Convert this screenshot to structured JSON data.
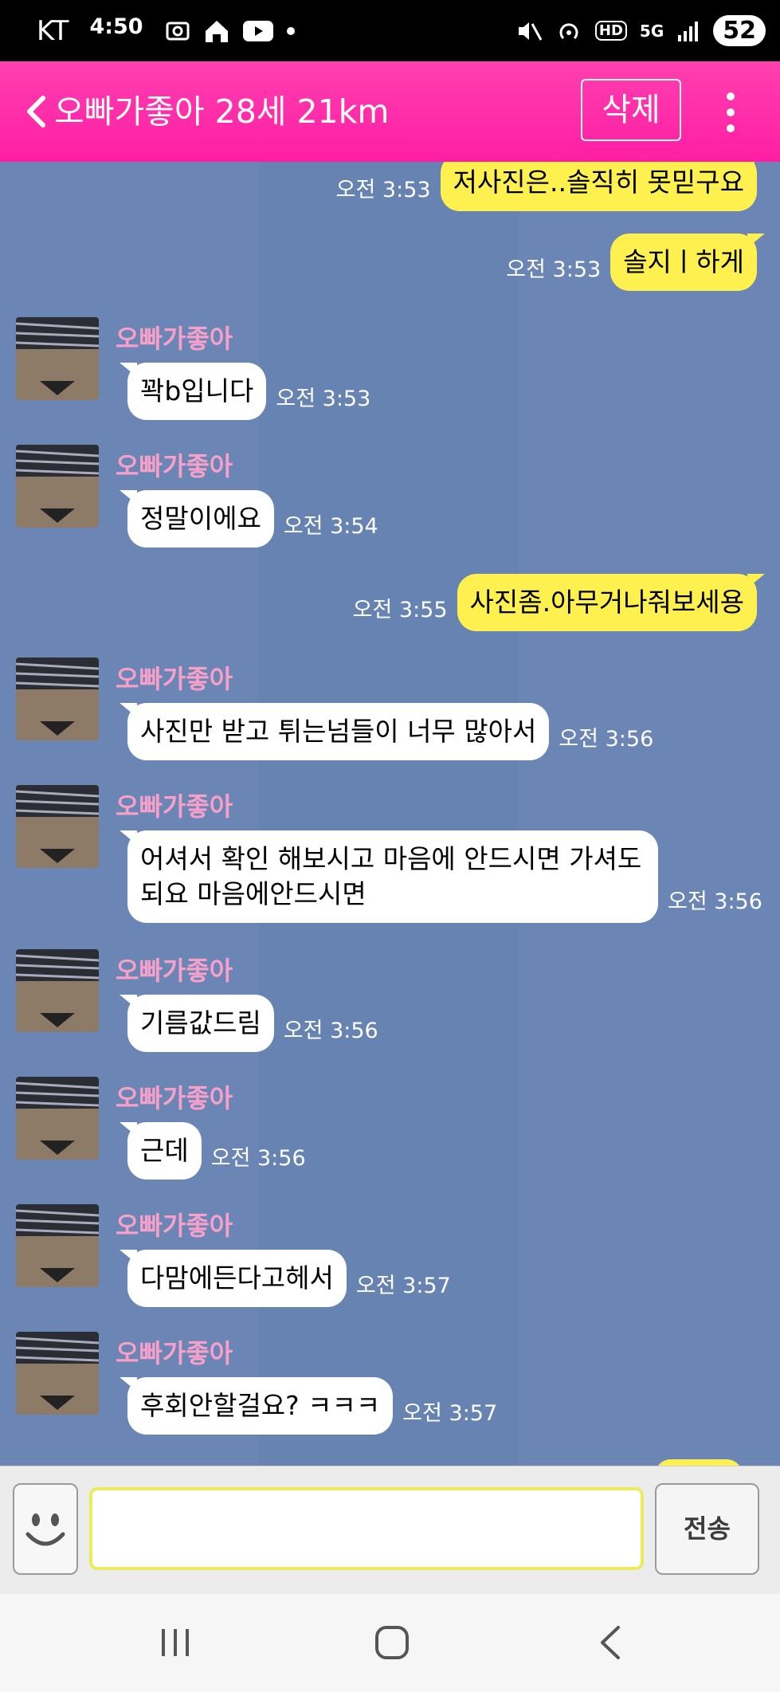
{
  "status_bar": {
    "carrier": "KT",
    "time": "4:50",
    "network": "5G",
    "hd": "HD",
    "battery": "52",
    "icons": [
      "screenshot-icon",
      "home-icon",
      "youtube-icon",
      "dot-icon",
      "mute-icon",
      "hotspot-icon",
      "hd-icon",
      "5g-icon",
      "signal-icon",
      "battery-icon"
    ]
  },
  "header": {
    "title": "오빠가좋아 28세 21km",
    "delete_label": "삭제",
    "back_icon": "back-chevron-icon",
    "more_icon": "more-vertical-icon"
  },
  "colors": {
    "header_bg": "#ff1ea3",
    "chat_bg": "#6b86b4",
    "my_bubble": "#fdf04f",
    "their_bubble": "#ffffff",
    "sender_name": "#f7a0c9"
  },
  "messages": [
    {
      "from": "me",
      "text": "저사진은..솔직히 못믿구요",
      "time": "오전 3:53"
    },
    {
      "from": "me",
      "text": "솔지ㅣ하게",
      "time": "오전 3:53"
    },
    {
      "from": "them",
      "sender": "오빠가좋아",
      "text": "꽉b입니다",
      "time": "오전 3:53"
    },
    {
      "from": "them",
      "sender": "오빠가좋아",
      "text": "정말이에요",
      "time": "오전 3:54"
    },
    {
      "from": "me",
      "text": "사진좀.아무거나줘보세용",
      "time": "오전 3:55"
    },
    {
      "from": "them",
      "sender": "오빠가좋아",
      "text": "사진만 받고 튀는넘들이 너무 많아서",
      "time": "오전 3:56"
    },
    {
      "from": "them",
      "sender": "오빠가좋아",
      "text": "어셔서 확인 해보시고 마음에 안드시면 가셔도 되요 마음에안드시면",
      "time": "오전 3:56"
    },
    {
      "from": "them",
      "sender": "오빠가좋아",
      "text": "기름값드림",
      "time": "오전 3:56"
    },
    {
      "from": "them",
      "sender": "오빠가좋아",
      "text": "근데",
      "time": "오전 3:56"
    },
    {
      "from": "them",
      "sender": "오빠가좋아",
      "text": "다맘에든다고헤서",
      "time": "오전 3:57"
    },
    {
      "from": "them",
      "sender": "오빠가좋아",
      "text": "후회안할걸요? ㅋㅋㅋ",
      "time": "오전 3:57"
    }
  ],
  "input_bar": {
    "placeholder": "",
    "value": "",
    "send_label": "전송",
    "emoji_icon": "smiley-icon"
  },
  "nav_bar": {
    "icons": [
      "recent-apps-icon",
      "home-icon",
      "back-icon"
    ]
  }
}
